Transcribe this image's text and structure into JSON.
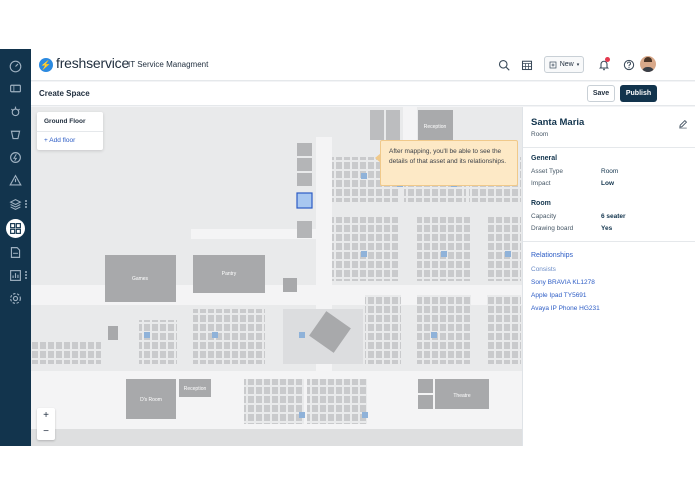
{
  "brand": {
    "logo_text": "freshservice",
    "app_name": "IT Service Managment",
    "accent": "#12344d"
  },
  "sidebar": {
    "items": [
      {
        "icon": "dashboard-icon"
      },
      {
        "icon": "tickets-icon"
      },
      {
        "icon": "problems-icon"
      },
      {
        "icon": "changes-icon"
      },
      {
        "icon": "releases-icon"
      },
      {
        "icon": "alerts-icon"
      },
      {
        "icon": "assets-icon"
      },
      {
        "icon": "space-planning-icon",
        "active": true
      },
      {
        "icon": "solutions-icon"
      },
      {
        "icon": "reports-icon"
      },
      {
        "icon": "admin-icon"
      }
    ]
  },
  "topbar": {
    "new_label": "New"
  },
  "header": {
    "title": "Create Space",
    "save_label": "Save",
    "publish_label": "Publish"
  },
  "map": {
    "floor_name": "Ground Floor",
    "add_floor_label": "+ Add floor",
    "tooltip": "After mapping, you'll be able to see the details of that asset and its relationships.",
    "rooms": {
      "reception_top": "Reception",
      "games": "Games",
      "pantry": "Pantry",
      "ds_room": "D's Room",
      "reception_bottom": "Reception",
      "theatre": "Theatre"
    },
    "zoom_in": "+",
    "zoom_out": "−"
  },
  "panel": {
    "title": "Santa Maria",
    "subtitle": "Room",
    "general": {
      "heading": "General",
      "rows": [
        {
          "label": "Asset Type",
          "value": "Room"
        },
        {
          "label": "Impact",
          "value": "Low"
        }
      ]
    },
    "room": {
      "heading": "Room",
      "rows": [
        {
          "label": "Capacity",
          "value": "6 seater"
        },
        {
          "label": "Drawing board",
          "value": "Yes"
        }
      ]
    },
    "relationships": {
      "heading": "Relationships",
      "consists_label": "Consists",
      "items": [
        "Sony BRAVIA KL1278",
        "Apple Ipad TY5691",
        "Avaya IP Phone HG231"
      ]
    }
  }
}
